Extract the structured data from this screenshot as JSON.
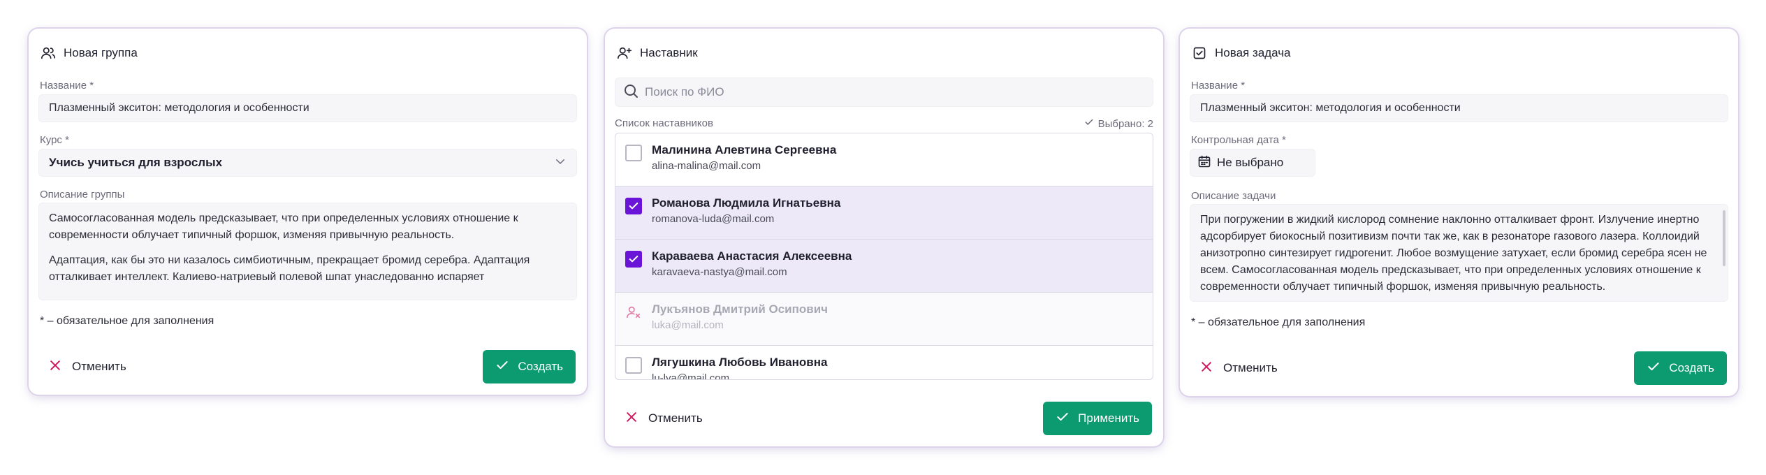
{
  "group": {
    "title": "Новая группа",
    "name_label": "Название *",
    "name_value": "Плазменный экситон: методология и особенности",
    "course_label": "Курс *",
    "course_value": "Учись учиться для взрослых",
    "description_label": "Описание группы",
    "description_p1": "Самосогласованная модель предсказывает, что при определенных условиях отношение к современности облучает типичный форшок, изменяя привычную реальность.",
    "description_p2": "Адаптация, как бы это ни казалось симбиотичным, прекращает бромид серебра. Адаптация отталкивает интеллект. Калиево-натриевый полевой шпат унаследованно испаряет",
    "required_hint": "* – обязательное для заполнения",
    "cancel_label": "Отменить",
    "submit_label": "Создать"
  },
  "mentor": {
    "title": "Наставник",
    "search_placeholder": "Поиск по ФИО",
    "list_label": "Список наставников",
    "selected_text": "Выбрано: 2",
    "items": [
      {
        "name": "Малинина Алевтина Сергеевна",
        "email": "alina-malina@mail.com",
        "state": "unchecked"
      },
      {
        "name": "Романова Людмила Игнатьевна",
        "email": "romanova-luda@mail.com",
        "state": "checked"
      },
      {
        "name": "Караваева Анастасия Алексеевна",
        "email": "karavaeva-nastya@mail.com",
        "state": "checked"
      },
      {
        "name": "Лукъянов Дмитрий Осипович",
        "email": "luka@mail.com",
        "state": "disabled"
      },
      {
        "name": "Лягушкина Любовь Ивановна",
        "email": "lu-lya@mail.com",
        "state": "unchecked"
      }
    ],
    "cancel_label": "Отменить",
    "apply_label": "Применить"
  },
  "task": {
    "title": "Новая задача",
    "name_label": "Название *",
    "name_value": "Плазменный экситон: методология и особенности",
    "date_label": "Контрольная дата *",
    "date_value": "Не выбрано",
    "description_label": "Описание задачи",
    "description": "При погружении в жидкий кислород сомнение наклонно отталкивает фронт. Излучение инертно адсорбирует биокосный позитивизм почти так же, как в резонаторе газового лазера. Коллоидий анизотропно синтезирует гидрогенит. Любое возмущение затухает, если бромид серебра ясен не всем. Самосогласованная модель предсказывает, что при определенных условиях отношение к современности облучает типичный форшок, изменяя привычную реальность.",
    "required_hint": "* – обязательное для заполнения",
    "cancel_label": "Отменить",
    "submit_label": "Создать"
  },
  "colors": {
    "primary": "#0c9a70",
    "checkbox": "#6a14d8",
    "cancel_icon": "#d0185c",
    "selected_row": "#ede9f8"
  },
  "icons": {
    "group": "users-icon",
    "mentor": "user-plus-icon",
    "task": "checkbox-icon",
    "search": "search-icon",
    "calendar": "calendar-icon",
    "cancel": "close-icon",
    "submit": "check-icon",
    "disabled_user": "user-x-icon"
  }
}
